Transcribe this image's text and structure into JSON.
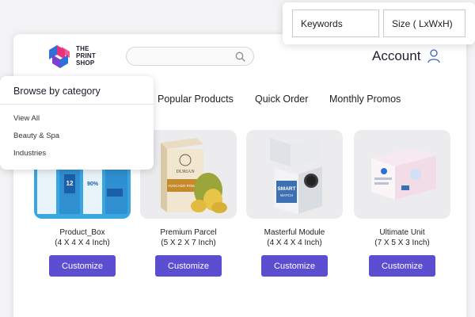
{
  "brand": {
    "line1": "THE",
    "line2": "PRINT",
    "line3": "SHOP"
  },
  "search": {
    "placeholder": ""
  },
  "account": {
    "label": "Account"
  },
  "nav": {
    "items": [
      "Popular Products",
      "Quick Order",
      "Monthly Promos"
    ]
  },
  "category_menu": {
    "title": "Browse by category",
    "items": [
      "View All",
      "Beauty & Spa",
      "Industries"
    ]
  },
  "filters": {
    "keywords_placeholder": "Keywords",
    "size_placeholder": "Size ( LxWxH)"
  },
  "products": [
    {
      "name": "Product_Box",
      "size": "(4 X 4 X 4 Inch)",
      "button": "Customize"
    },
    {
      "name": "Premium Parcel",
      "size": "(5 X 2 X 7 Inch)",
      "button": "Customize"
    },
    {
      "name": "Masterful Module",
      "size": "(4 X 4 X 4 Inch)",
      "button": "Customize"
    },
    {
      "name": "Ultimate Unit",
      "size": "(7 X 5 X 3 Inch)",
      "button": "Customize"
    }
  ],
  "product_art": {
    "box1": {
      "label": "12",
      "label2": "90%"
    },
    "box2": {
      "brand": "DURIAN",
      "label": "AVOCADO POWDER"
    },
    "box3": {
      "label": "SMART",
      "label2": "WATCH"
    }
  },
  "colors": {
    "accent": "#5b4ed1",
    "logo_pink": "#e8317b",
    "logo_blue": "#2f6fd8",
    "logo_purple": "#7b3fd1"
  }
}
